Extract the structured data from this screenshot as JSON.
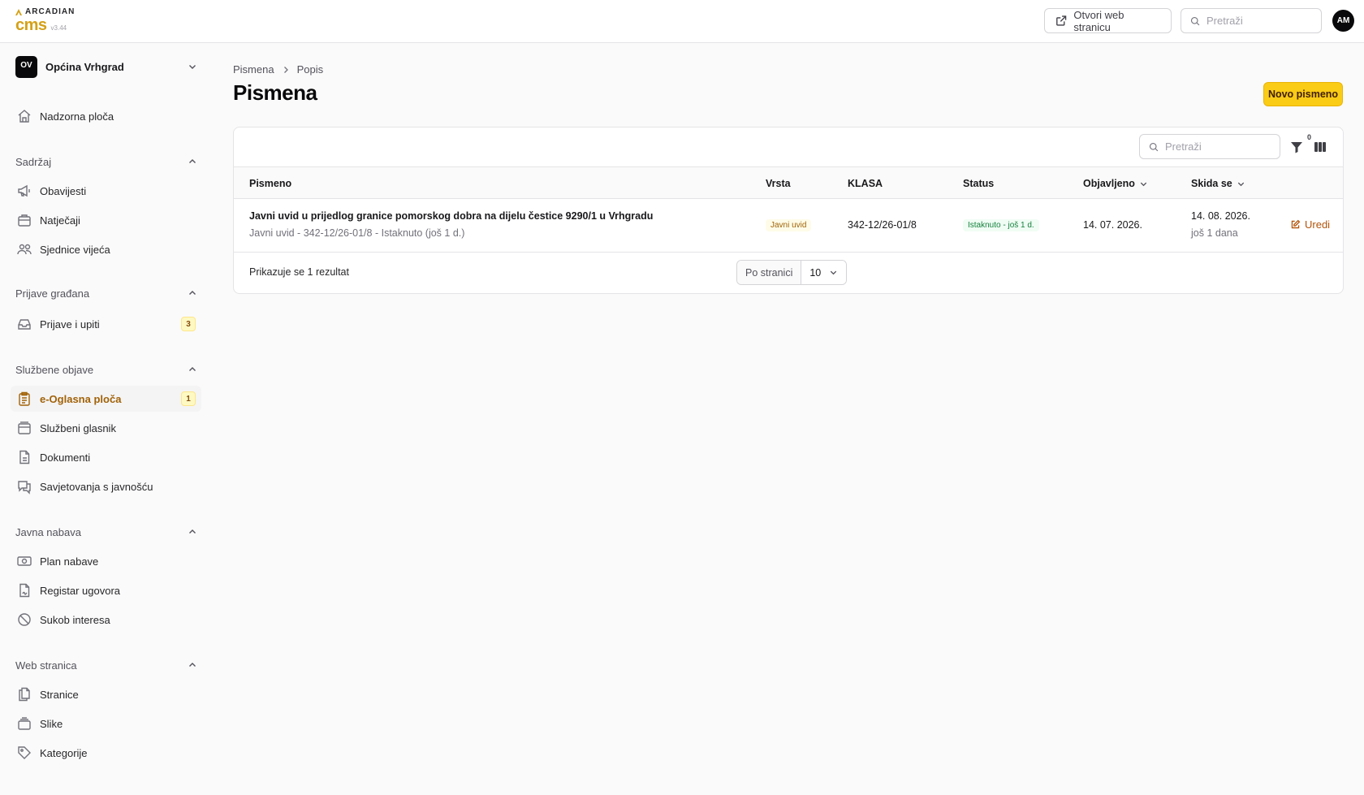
{
  "app": {
    "brand": "ARCADIAN",
    "product": "cms",
    "version": "v3.44",
    "open_site_label": "Otvori web stranicu",
    "search_placeholder": "Pretraži",
    "user_initials": "AM",
    "accent_color": "#facc15"
  },
  "sidebar": {
    "org_initials": "OV",
    "org_name": "Općina Vrhgrad",
    "dashboard": "Nadzorna ploča",
    "sections": [
      {
        "title": "Sadržaj",
        "items": [
          "Obavijesti",
          "Natječaji",
          "Sjednice vijeća"
        ]
      },
      {
        "title": "Prijave građana",
        "items": [
          "Prijave i upiti"
        ],
        "badge": "3"
      },
      {
        "title": "Službene objave",
        "items": [
          "e-Oglasna ploča",
          "Službeni glasnik",
          "Dokumenti",
          "Savjetovanja s javnošću"
        ],
        "badge": "1"
      },
      {
        "title": "Javna nabava",
        "items": [
          "Plan nabave",
          "Registar ugovora",
          "Sukob interesa"
        ]
      },
      {
        "title": "Web stranica",
        "items": [
          "Stranice",
          "Slike",
          "Kategorije"
        ]
      }
    ]
  },
  "page": {
    "breadcrumb": [
      "Pismena",
      "Popis"
    ],
    "title": "Pismena",
    "new_button": "Novo pismeno"
  },
  "table": {
    "search_placeholder": "Pretraži",
    "filter_count": "0",
    "columns": [
      "Pismeno",
      "Vrsta",
      "KLASA",
      "Status",
      "Objavljeno",
      "Skida se"
    ],
    "rows": [
      {
        "title": "Javni uvid u prijedlog granice pomorskog dobra na dijelu čestice 9290/1 u Vrhgradu",
        "subtitle": "Javni uvid - 342-12/26-01/8 - Istaknuto (još 1 d.)",
        "type": "Javni uvid",
        "klasa": "342-12/26-01/8",
        "status": "Istaknuto - još 1 d.",
        "published": "14. 07. 2026.",
        "removed": "14. 08. 2026.",
        "removed_note": "još 1 dana",
        "edit_label": "Uredi"
      }
    ],
    "result_text": "Prikazuje se 1 rezultat",
    "per_page_label": "Po stranici",
    "per_page_value": "10"
  }
}
